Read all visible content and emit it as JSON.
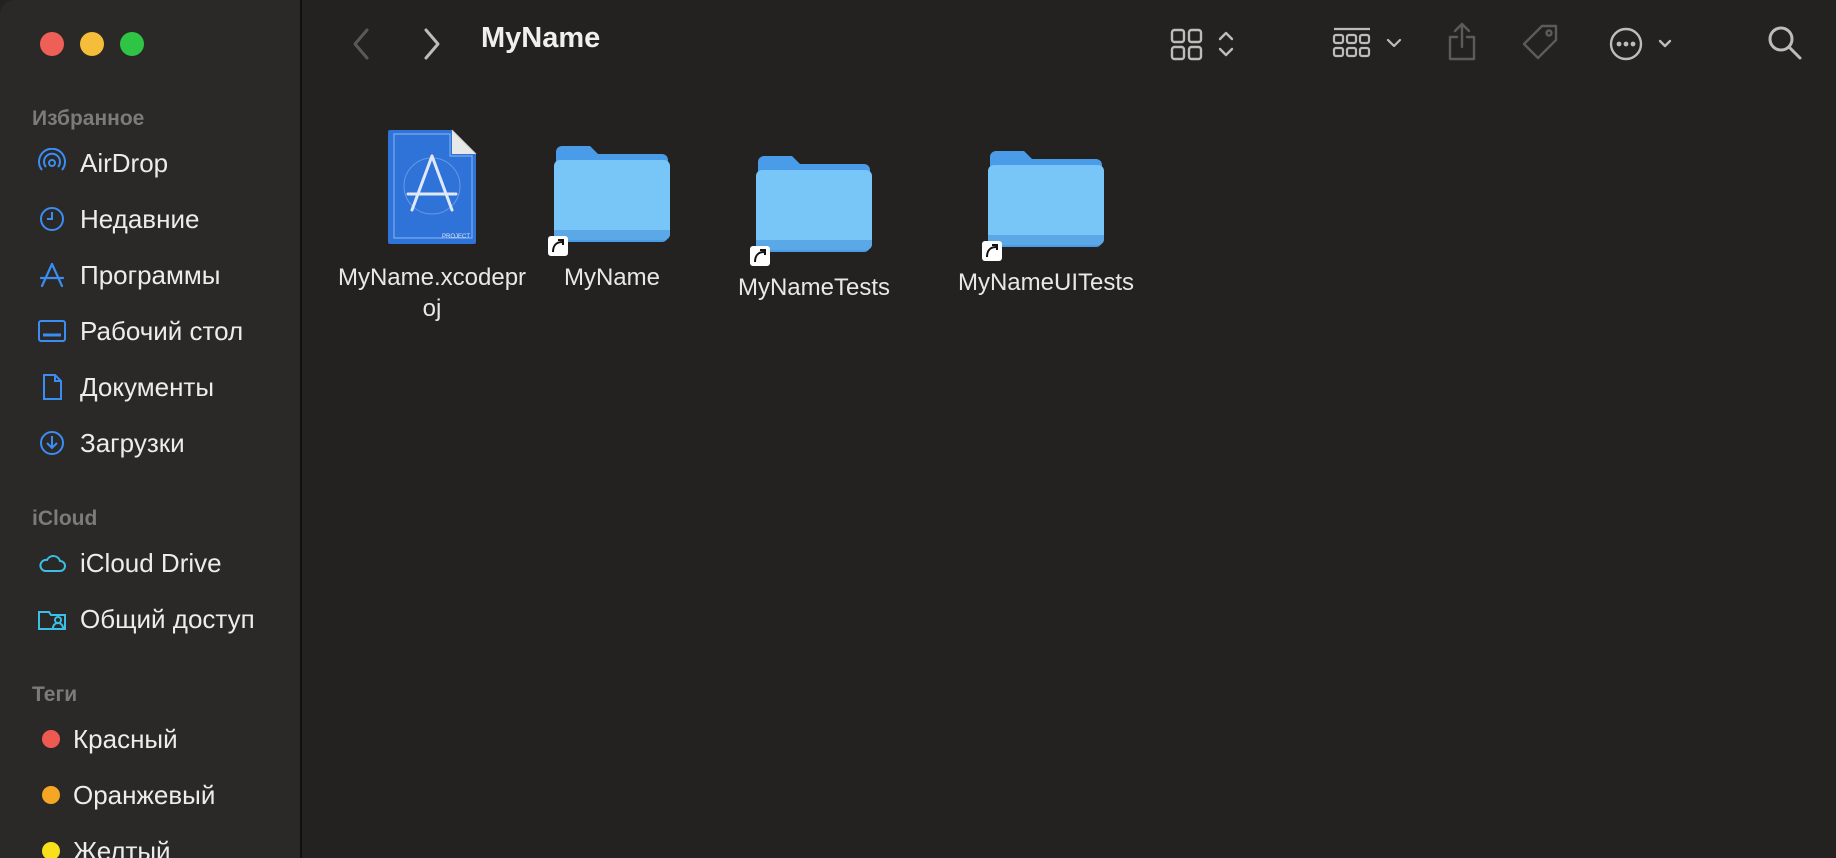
{
  "window": {
    "title": "MyName"
  },
  "toolbar": {
    "back_icon": "chevron-left-icon",
    "forward_icon": "chevron-right-icon",
    "view_icon": "grid-view-icon",
    "group_icon": "group-by-icon",
    "share_icon": "share-icon",
    "tag_icon": "tag-icon",
    "more_icon": "ellipsis-circle-icon",
    "search_icon": "search-icon"
  },
  "sidebar": {
    "favorites_title": "Избранное",
    "favorites": [
      {
        "label": "AirDrop",
        "icon": "airdrop-icon"
      },
      {
        "label": "Недавние",
        "icon": "clock-icon"
      },
      {
        "label": "Программы",
        "icon": "applications-icon"
      },
      {
        "label": "Рабочий стол",
        "icon": "desktop-icon"
      },
      {
        "label": "Документы",
        "icon": "document-icon"
      },
      {
        "label": "Загрузки",
        "icon": "download-icon"
      }
    ],
    "icloud_title": "iCloud",
    "icloud": [
      {
        "label": "iCloud Drive",
        "icon": "cloud-icon"
      },
      {
        "label": "Общий доступ",
        "icon": "shared-folder-icon"
      }
    ],
    "tags_title": "Теги",
    "tags": [
      {
        "label": "Красный",
        "color": "#ee5a52"
      },
      {
        "label": "Оранжевый",
        "color": "#f5a623"
      },
      {
        "label": "Желтый",
        "color": "#f8e11a"
      }
    ]
  },
  "files": [
    {
      "name": "MyName.xcodeproj",
      "line1": "MyName.xcodepr",
      "line2": "oj",
      "type": "xcodeproj",
      "badge": "PROJECT"
    },
    {
      "name": "MyName",
      "type": "folder-alias"
    },
    {
      "name": "MyNameTests",
      "type": "folder-alias"
    },
    {
      "name": "MyNameUITests",
      "type": "folder-alias"
    }
  ],
  "colors": {
    "accent": "#2f8bff",
    "folder": "#6cbcf5",
    "sidebar_bg": "#2a2927",
    "content_bg": "#232220"
  }
}
